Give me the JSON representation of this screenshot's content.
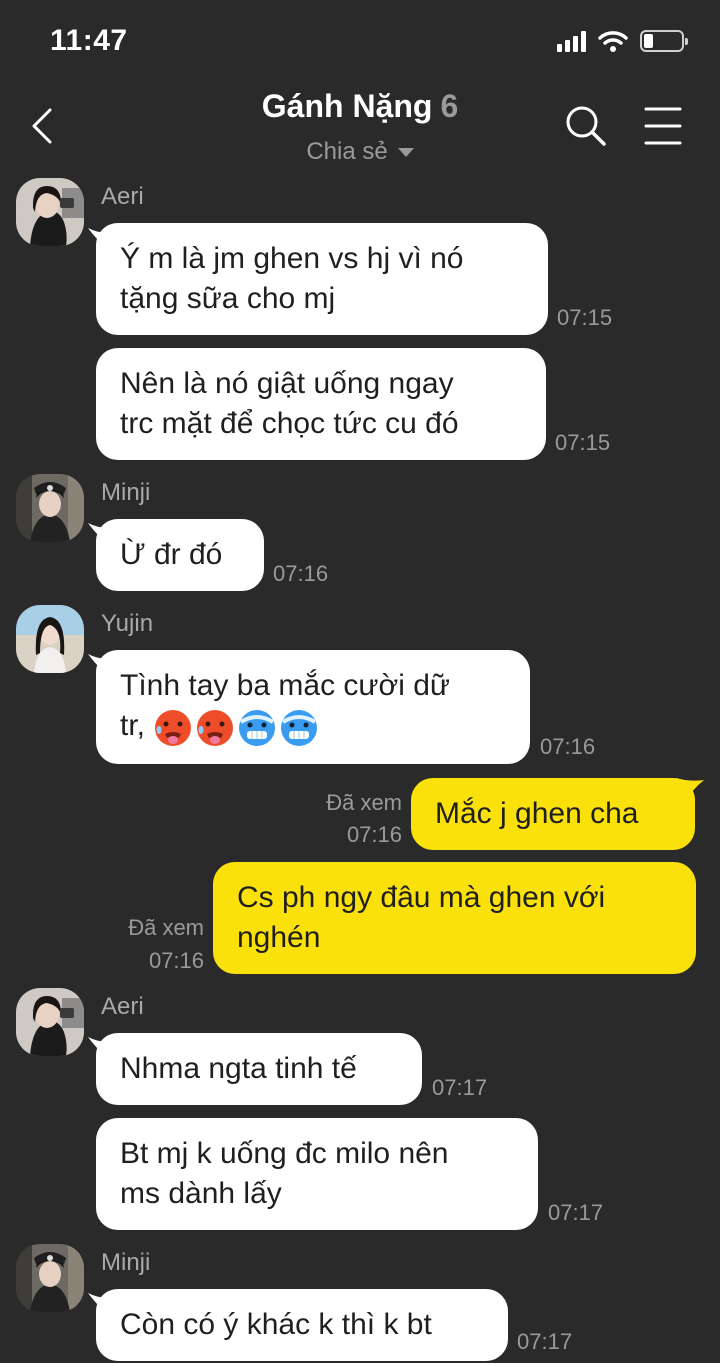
{
  "status_bar": {
    "time": "11:47",
    "battery_level": 0.25
  },
  "header": {
    "title": "Gánh Nặng",
    "member_count": "6",
    "subtitle": "Chia sẻ"
  },
  "messages": [
    {
      "sender": "Aeri",
      "text_lines": [
        "Ý m là jm ghen vs hj vì nó",
        "tặng sữa cho mj"
      ],
      "time": "07:15"
    },
    {
      "text_lines": [
        "Nên là nó giật uống ngay",
        "trc mặt để chọc tức cu đó"
      ],
      "time": "07:15"
    },
    {
      "sender": "Minji",
      "text": "Ừ đr đó",
      "time": "07:16"
    },
    {
      "sender": "Yujin",
      "text_line1": "Tình tay ba mắc cười dữ",
      "text_line2": "tr,",
      "emojis": [
        "hot-face",
        "hot-face",
        "cold-face",
        "cold-face"
      ],
      "time": "07:16"
    },
    {
      "read_status": "Đã xem",
      "time": "07:16",
      "text": "Mắc j ghen cha"
    },
    {
      "read_status": "Đã xem",
      "time": "07:16",
      "text_lines": [
        "Cs ph ngy đâu mà ghen với",
        "nghén"
      ]
    },
    {
      "sender": "Aeri",
      "text": "Nhma ngta tinh tế",
      "time": "07:17"
    },
    {
      "text_lines": [
        "Bt mj k uống đc milo nên",
        "ms dành lấy"
      ],
      "time": "07:17"
    },
    {
      "sender": "Minji",
      "text": "Còn có ý khác k thì k bt",
      "time": "07:17"
    }
  ],
  "colors": {
    "background": "#2a2a2b",
    "incoming_bubble": "#ffffff",
    "outgoing_bubble": "#fae10b",
    "meta_text": "#9a9a9a"
  }
}
